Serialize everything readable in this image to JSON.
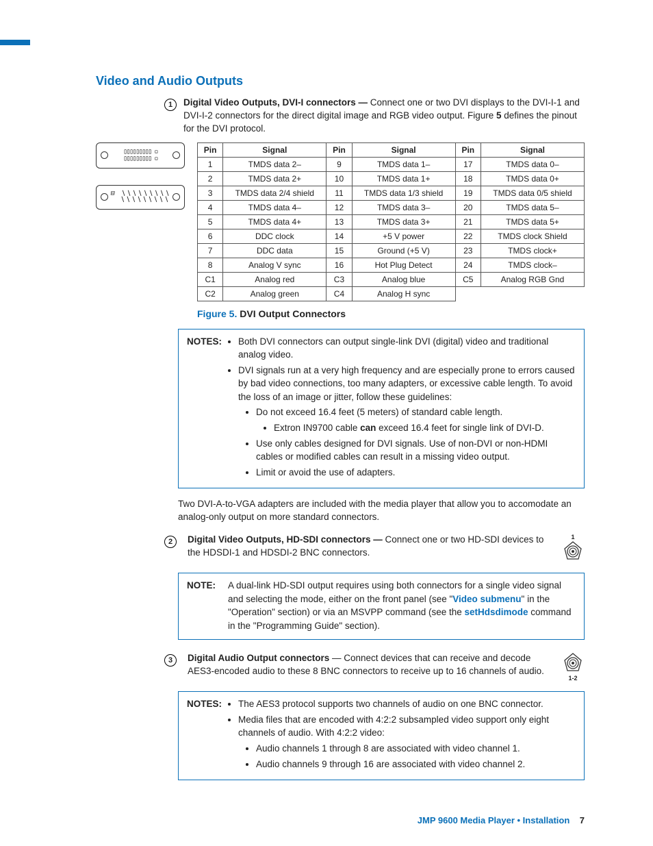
{
  "section_heading": "Video and Audio Outputs",
  "callout1": {
    "num": "1",
    "lead": "Digital Video Outputs, DVI-I connectors — ",
    "text1": "Connect one or two DVI displays to the DVI-I-1 and DVI-I-2 connectors for the direct digital image and RGB video output. Figure ",
    "fig_ref": "5",
    "text2": " defines the pinout for the DVI protocol."
  },
  "table": {
    "headers": [
      "Pin",
      "Signal",
      "Pin",
      "Signal",
      "Pin",
      "Signal"
    ],
    "rows": [
      [
        "1",
        "TMDS data 2–",
        "9",
        "TMDS data 1–",
        "17",
        "TMDS data 0–"
      ],
      [
        "2",
        "TMDS data 2+",
        "10",
        "TMDS data 1+",
        "18",
        "TMDS data 0+"
      ],
      [
        "3",
        "TMDS data 2/4 shield",
        "11",
        "TMDS data 1/3 shield",
        "19",
        "TMDS data 0/5 shield"
      ],
      [
        "4",
        "TMDS data 4–",
        "12",
        "TMDS data 3–",
        "20",
        "TMDS data 5–"
      ],
      [
        "5",
        "TMDS data 4+",
        "13",
        "TMDS data 3+",
        "21",
        "TMDS data 5+"
      ],
      [
        "6",
        "DDC clock",
        "14",
        "+5 V power",
        "22",
        "TMDS clock Shield"
      ],
      [
        "7",
        "DDC data",
        "15",
        "Ground (+5 V)",
        "23",
        "TMDS clock+"
      ],
      [
        "8",
        "Analog V sync",
        "16",
        "Hot Plug Detect",
        "24",
        "TMDS clock–"
      ],
      [
        "C1",
        "Analog red",
        "C3",
        "Analog blue",
        "C5",
        "Analog RGB Gnd"
      ],
      [
        "C2",
        "Analog green",
        "C4",
        "Analog H sync",
        "",
        ""
      ]
    ]
  },
  "figure_caption": {
    "label": "Figure 5.",
    "text": "DVI Output Connectors"
  },
  "notes1": {
    "label": "NOTES:",
    "b1": "Both DVI connectors can output single-link DVI (digital) video and traditional analog video.",
    "b2": "DVI signals run at a very high frequency and are especially prone to errors caused by bad video connections, too many adapters, or excessive cable length. To avoid the loss of an image or jitter, follow these guidelines:",
    "s1": "Do not exceed 16.4 feet (5 meters) of standard cable length.",
    "s1a_pre": "Extron IN9700 cable ",
    "s1a_bold": "can",
    "s1a_post": " exceed 16.4 feet for single link of DVI-D.",
    "s2": "Use only cables designed for DVI signals. Use of non-DVI or non-HDMI cables or modified cables can result in a missing video output.",
    "s3": "Limit or avoid the use of adapters."
  },
  "para_after": "Two DVI-A-to-VGA adapters are included with the media player that allow you to accomodate an analog-only output on more standard connectors.",
  "callout2": {
    "num": "2",
    "lead": "Digital Video Outputs, HD-SDI connectors — ",
    "text": "Connect one or two HD-SDI devices to the HDSDI-1 and HDSDI-2 BNC connectors.",
    "bnc_label": "1"
  },
  "note2": {
    "label": "NOTE:",
    "pre": "A dual-link HD-SDI output requires using both connectors for a single video signal and selecting the mode, either on the front panel (see \"",
    "link1": "Video submenu",
    "mid": "\" in the \"Operation\" section) or via an MSVPP command (see the ",
    "link2": "setHdsdimode",
    "post": " command in the \"Programming Guide\" section)."
  },
  "callout3": {
    "num": "3",
    "lead": "Digital Audio Output connectors",
    "text": " — Connect devices that can receive and decode AES3-encoded audio to these 8 BNC connectors to receive up to 16 channels of audio.",
    "bnc_label": "1-2"
  },
  "notes3": {
    "label": "NOTES:",
    "b1": "The AES3 protocol supports two channels of audio on one BNC connector.",
    "b2": "Media files that are encoded with 4:2:2 subsampled video support only eight channels of audio. With 4:2:2 video:",
    "s1": "Audio channels 1 through 8 are associated with video channel 1.",
    "s2": "Audio channels 9 through 16 are associated with video channel 2."
  },
  "footer": {
    "text": "JMP 9600 Media Player • Installation",
    "page": "7"
  }
}
